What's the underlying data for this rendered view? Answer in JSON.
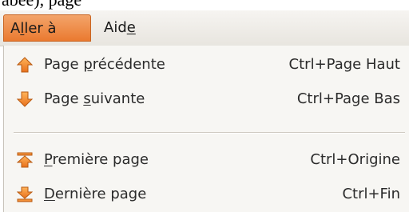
{
  "background_snippet": "abée), page",
  "menubar": {
    "items": [
      {
        "pre": "A",
        "mnemonic": "l",
        "post": "ler à",
        "active": true
      },
      {
        "pre": "Aid",
        "mnemonic": "e",
        "post": "",
        "active": false
      }
    ]
  },
  "menu": {
    "items": [
      {
        "pre": "Page ",
        "mnemonic": "p",
        "post": "récédente",
        "shortcut": "Ctrl+Page Haut",
        "icon": "arrow-up-icon"
      },
      {
        "pre": "Page ",
        "mnemonic": "s",
        "post": "uivante",
        "shortcut": "Ctrl+Page Bas",
        "icon": "arrow-down-icon"
      },
      {
        "pre": "",
        "mnemonic": "P",
        "post": "remière page",
        "shortcut": "Ctrl+Origine",
        "icon": "first-page-icon"
      },
      {
        "pre": "",
        "mnemonic": "D",
        "post": "ernière page",
        "shortcut": "Ctrl+Fin",
        "icon": "last-page-icon"
      }
    ]
  },
  "colors": {
    "accent": "#ea7a30",
    "icon_orange": "#f08a24",
    "menu_background": "#f7f6f3"
  }
}
